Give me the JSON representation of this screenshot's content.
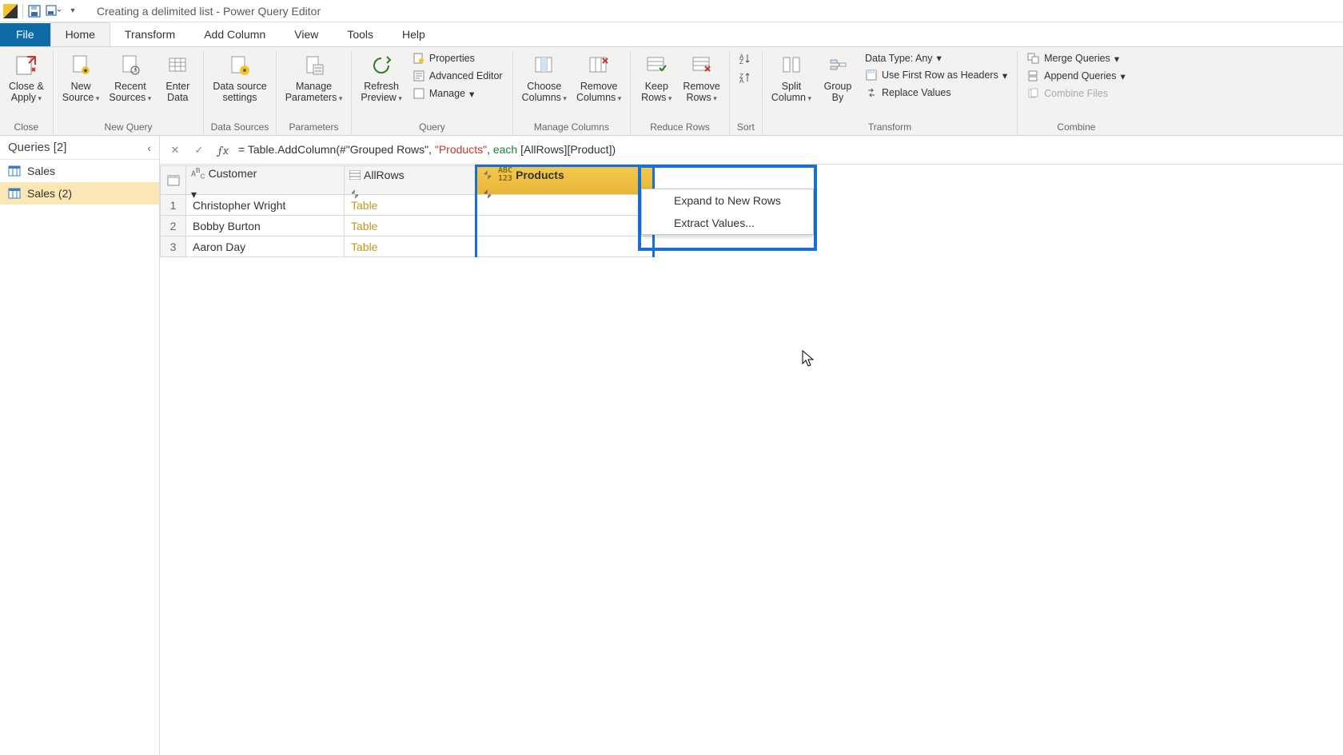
{
  "titlebar": {
    "title": "Creating a delimited list - Power Query Editor"
  },
  "tabs": {
    "file": "File",
    "home": "Home",
    "transform": "Transform",
    "addcol": "Add Column",
    "view": "View",
    "tools": "Tools",
    "help": "Help"
  },
  "ribbon": {
    "close_apply": "Close &\nApply",
    "close_group": "Close",
    "new_source": "New\nSource",
    "recent_sources": "Recent\nSources",
    "enter_data": "Enter\nData",
    "new_query_group": "New Query",
    "data_source_settings": "Data source\nsettings",
    "data_sources_group": "Data Sources",
    "manage_parameters": "Manage\nParameters",
    "parameters_group": "Parameters",
    "refresh_preview": "Refresh\nPreview",
    "properties": "Properties",
    "advanced_editor": "Advanced Editor",
    "manage": "Manage",
    "query_group": "Query",
    "choose_columns": "Choose\nColumns",
    "remove_columns": "Remove\nColumns",
    "manage_columns_group": "Manage Columns",
    "keep_rows": "Keep\nRows",
    "remove_rows": "Remove\nRows",
    "reduce_rows_group": "Reduce Rows",
    "sort_group": "Sort",
    "split_column": "Split\nColumn",
    "group_by": "Group\nBy",
    "data_type": "Data Type: Any",
    "first_row_headers": "Use First Row as Headers",
    "replace_values": "Replace Values",
    "transform_group": "Transform",
    "merge_queries": "Merge Queries",
    "append_queries": "Append Queries",
    "combine_files": "Combine Files",
    "combine_group": "Combine"
  },
  "queries": {
    "header": "Queries [2]",
    "items": [
      "Sales",
      "Sales (2)"
    ]
  },
  "formula": {
    "prefix": "= Table.AddColumn(#\"Grouped Rows\", ",
    "str": "\"Products\"",
    "mid": ", ",
    "kw": "each",
    "suffix": " [AllRows][Product])"
  },
  "columns": {
    "customer": "Customer",
    "allrows": "AllRows",
    "products": "Products"
  },
  "rows": [
    {
      "n": "1",
      "customer": "Christopher Wright",
      "allrows": "Table"
    },
    {
      "n": "2",
      "customer": "Bobby Burton",
      "allrows": "Table"
    },
    {
      "n": "3",
      "customer": "Aaron Day",
      "allrows": "Table"
    }
  ],
  "dropdown": {
    "expand": "Expand to New Rows",
    "extract": "Extract Values..."
  }
}
